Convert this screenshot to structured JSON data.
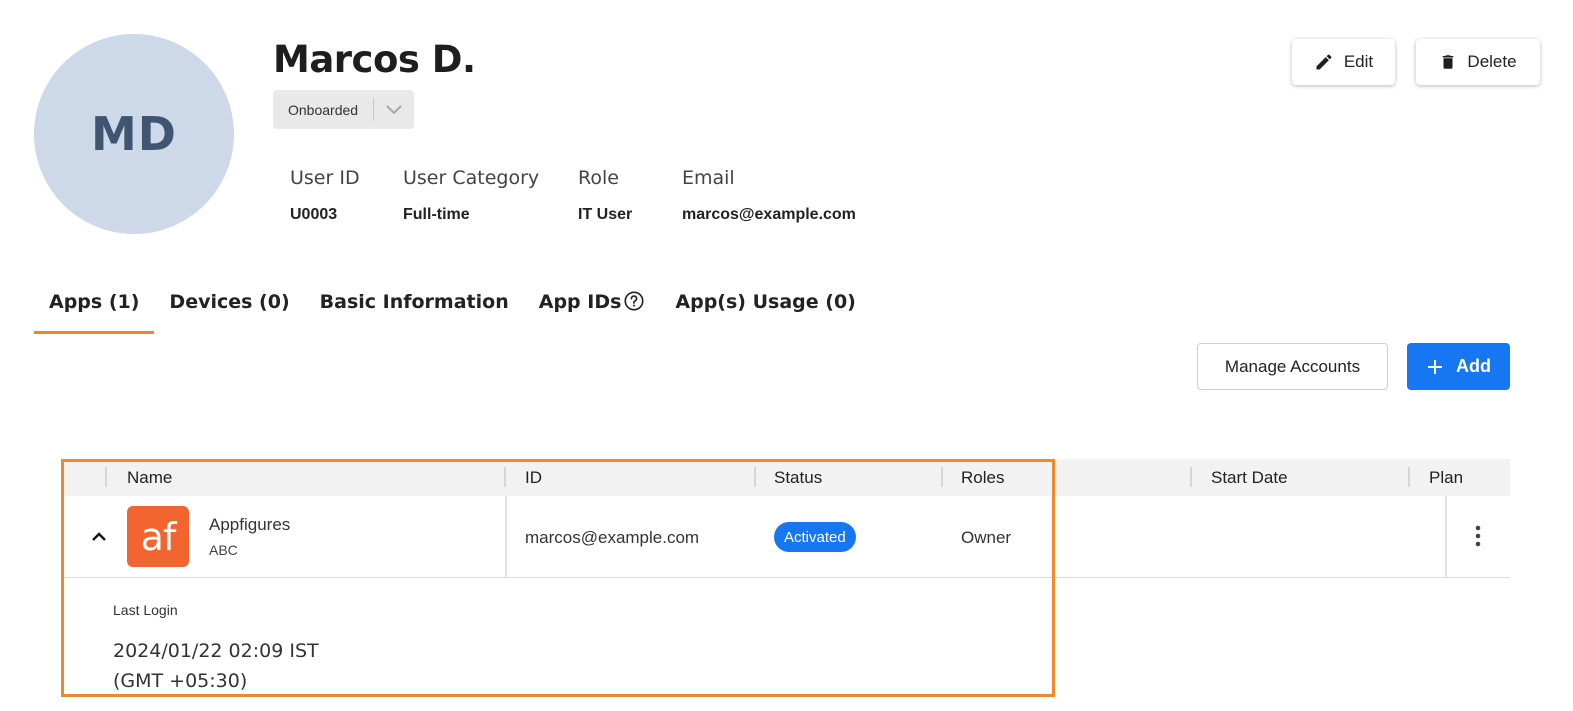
{
  "profile": {
    "initials": "MD",
    "name": "Marcos D.",
    "status": "Onboarded",
    "fields": [
      {
        "label": "User ID",
        "value": "U0003"
      },
      {
        "label": "User Category",
        "value": "Full-time"
      },
      {
        "label": "Role",
        "value": "IT User"
      },
      {
        "label": "Email",
        "value": "marcos@example.com"
      }
    ]
  },
  "actions": {
    "edit": "Edit",
    "delete": "Delete"
  },
  "tabs": [
    {
      "label": "Apps (1)",
      "active": true
    },
    {
      "label": "Devices (0)",
      "active": false
    },
    {
      "label": "Basic Information",
      "active": false
    },
    {
      "label": "App IDs",
      "active": false
    },
    {
      "label": "App(s) Usage (0)",
      "active": false
    }
  ],
  "toolbar": {
    "manage": "Manage Accounts",
    "add": "Add"
  },
  "table": {
    "columns": [
      "Name",
      "ID",
      "Status",
      "Roles",
      "Start Date",
      "Plan"
    ],
    "rows": [
      {
        "logo_text": "af",
        "name": "Appfigures",
        "sub": "ABC",
        "id": "marcos@example.com",
        "status": "Activated",
        "role": "Owner",
        "start_date": "",
        "plan": ""
      }
    ],
    "detail": {
      "label": "Last Login",
      "value_line1": "2024/01/22 02:09 IST",
      "value_line2": "(GMT +05:30)"
    }
  },
  "colors": {
    "accent": "#f0832b",
    "primary": "#1777f2",
    "avatar_bg": "#cdd9e8",
    "app_logo": "#f26430"
  }
}
